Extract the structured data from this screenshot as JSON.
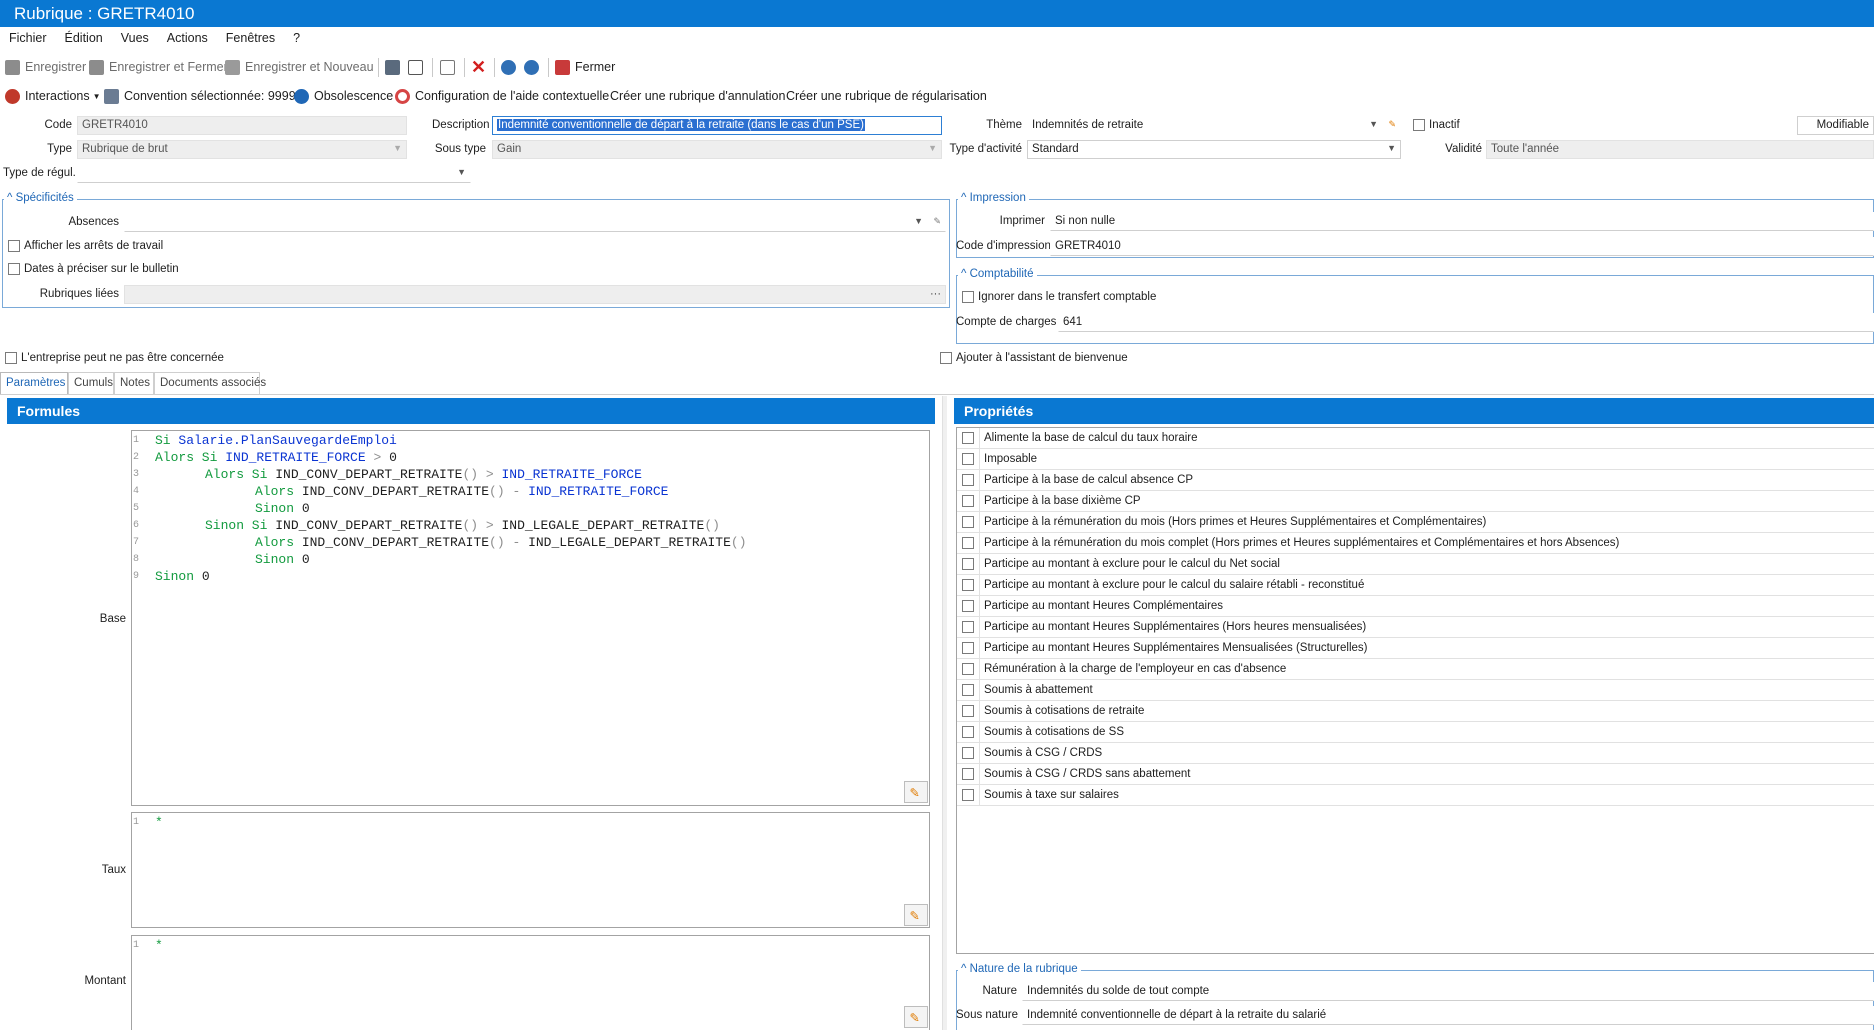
{
  "window": {
    "title": "Rubrique : GRETR4010"
  },
  "menu": [
    "Fichier",
    "Édition",
    "Vues",
    "Actions",
    "Fenêtres",
    "?"
  ],
  "toolbar": {
    "save": "Enregistrer",
    "save_close": "Enregistrer et Fermer",
    "save_new": "Enregistrer et Nouveau",
    "close": "Fermer"
  },
  "toolbar2": {
    "interactions": "Interactions",
    "convention": "Convention sélectionnée: 9999",
    "obsolescence": "Obsolescence",
    "help_config": "Configuration de l'aide contextuelle",
    "create_cancel": "Créer une rubrique d'annulation",
    "create_regul": "Créer une rubrique de régularisation"
  },
  "form": {
    "code_label": "Code",
    "code_value": "GRETR4010",
    "description_label": "Description",
    "description_value": "Indemnité conventionnelle de départ à la retraite (dans le cas d'un PSE)",
    "theme_label": "Thème",
    "theme_value": "Indemnités de retraite",
    "inactif_label": "Inactif",
    "modifiable_label": "Modifiable",
    "type_label": "Type",
    "type_value": "Rubrique de brut",
    "sous_type_label": "Sous type",
    "sous_type_value": "Gain",
    "type_activite_label": "Type d'activité",
    "type_activite_value": "Standard",
    "validite_label": "Validité",
    "validite_value": "Toute l'année",
    "type_regul_label": "Type de régul.",
    "type_regul_value": ""
  },
  "specificites": {
    "title": "Spécificités",
    "absences_label": "Absences",
    "arrets_label": "Afficher les arrêts de travail",
    "dates_label": "Dates à préciser sur le bulletin",
    "rubriques_liees_label": "Rubriques liées"
  },
  "impression": {
    "title": "Impression",
    "imprimer_label": "Imprimer",
    "imprimer_value": "Si non nulle",
    "code_impression_label": "Code d'impression",
    "code_impression_value": "GRETR4010"
  },
  "comptabilite": {
    "title": "Comptabilité",
    "ignorer_label": "Ignorer dans le transfert comptable",
    "compte_label": "Compte de charges",
    "compte_value": "641"
  },
  "options": {
    "entreprise_label": "L'entreprise peut ne pas être concernée",
    "assistant_label": "Ajouter à l'assistant de bienvenue"
  },
  "tabs": [
    "Paramètres",
    "Cumuls",
    "Notes",
    "Documents associés"
  ],
  "formules": {
    "title": "Formules",
    "base_label": "Base",
    "taux_label": "Taux",
    "montant_label": "Montant",
    "base_lines": [
      {
        "n": "1",
        "indent": 0,
        "tokens": [
          [
            "kw",
            "Si "
          ],
          [
            "id",
            "Salarie.PlanSauvegardeEmploi"
          ]
        ]
      },
      {
        "n": "2",
        "indent": 0,
        "tokens": [
          [
            "kw",
            "Alors Si "
          ],
          [
            "id",
            "IND_RETRAITE_FORCE"
          ],
          [
            "op",
            " > "
          ],
          [
            "tx",
            "0"
          ]
        ]
      },
      {
        "n": "3",
        "indent": 1,
        "tokens": [
          [
            "kw",
            "Alors Si "
          ],
          [
            "tx",
            "IND_CONV_DEPART_RETRAITE"
          ],
          [
            "op",
            "() > "
          ],
          [
            "id",
            "IND_RETRAITE_FORCE"
          ]
        ]
      },
      {
        "n": "4",
        "indent": 2,
        "tokens": [
          [
            "kw",
            "Alors "
          ],
          [
            "tx",
            "IND_CONV_DEPART_RETRAITE"
          ],
          [
            "op",
            "() - "
          ],
          [
            "id",
            "IND_RETRAITE_FORCE"
          ]
        ]
      },
      {
        "n": "5",
        "indent": 2,
        "tokens": [
          [
            "kw",
            "Sinon "
          ],
          [
            "tx",
            "0"
          ]
        ]
      },
      {
        "n": "6",
        "indent": 1,
        "tokens": [
          [
            "kw",
            "Sinon Si "
          ],
          [
            "tx",
            "IND_CONV_DEPART_RETRAITE"
          ],
          [
            "op",
            "() > "
          ],
          [
            "tx",
            "IND_LEGALE_DEPART_RETRAITE"
          ],
          [
            "op",
            "()"
          ]
        ]
      },
      {
        "n": "7",
        "indent": 2,
        "tokens": [
          [
            "kw",
            "Alors "
          ],
          [
            "tx",
            "IND_CONV_DEPART_RETRAITE"
          ],
          [
            "op",
            "() - "
          ],
          [
            "tx",
            "IND_LEGALE_DEPART_RETRAITE"
          ],
          [
            "op",
            "()"
          ]
        ]
      },
      {
        "n": "8",
        "indent": 2,
        "tokens": [
          [
            "kw",
            "Sinon "
          ],
          [
            "tx",
            "0"
          ]
        ]
      },
      {
        "n": "9",
        "indent": 0,
        "tokens": [
          [
            "kw",
            "Sinon "
          ],
          [
            "tx",
            "0"
          ]
        ]
      }
    ],
    "taux_lines": [
      {
        "n": "1",
        "indent": 0,
        "tokens": [
          [
            "kw",
            "*"
          ]
        ]
      }
    ],
    "montant_lines": [
      {
        "n": "1",
        "indent": 0,
        "tokens": [
          [
            "kw",
            "*"
          ]
        ]
      }
    ]
  },
  "proprietes": {
    "title": "Propriétés",
    "items": [
      "Alimente la base de calcul du taux horaire",
      "Imposable",
      "Participe à la base de calcul absence CP",
      "Participe à la base dixième CP",
      "Participe à la rémunération du mois (Hors primes et Heures Supplémentaires et Complémentaires)",
      "Participe à la rémunération du mois complet (Hors primes et Heures supplémentaires et Complémentaires et hors Absences)",
      "Participe au montant à exclure pour le calcul du Net social",
      "Participe au montant à exclure pour le calcul du salaire rétabli - reconstitué",
      "Participe au montant Heures Complémentaires",
      "Participe au montant Heures Supplémentaires (Hors heures mensualisées)",
      "Participe au montant Heures Supplémentaires Mensualisées (Structurelles)",
      "Rémunération à la charge de l'employeur en cas d'absence",
      "Soumis à abattement",
      "Soumis à cotisations de retraite",
      "Soumis à cotisations de SS",
      "Soumis à CSG / CRDS",
      "Soumis à CSG / CRDS sans abattement",
      "Soumis à taxe sur salaires"
    ]
  },
  "nature": {
    "title": "Nature de la rubrique",
    "nature_label": "Nature",
    "nature_value": "Indemnités du solde de tout compte",
    "sous_nature_label": "Sous nature",
    "sous_nature_value": "Indemnité conventionnelle de départ à la retraite du salarié"
  }
}
